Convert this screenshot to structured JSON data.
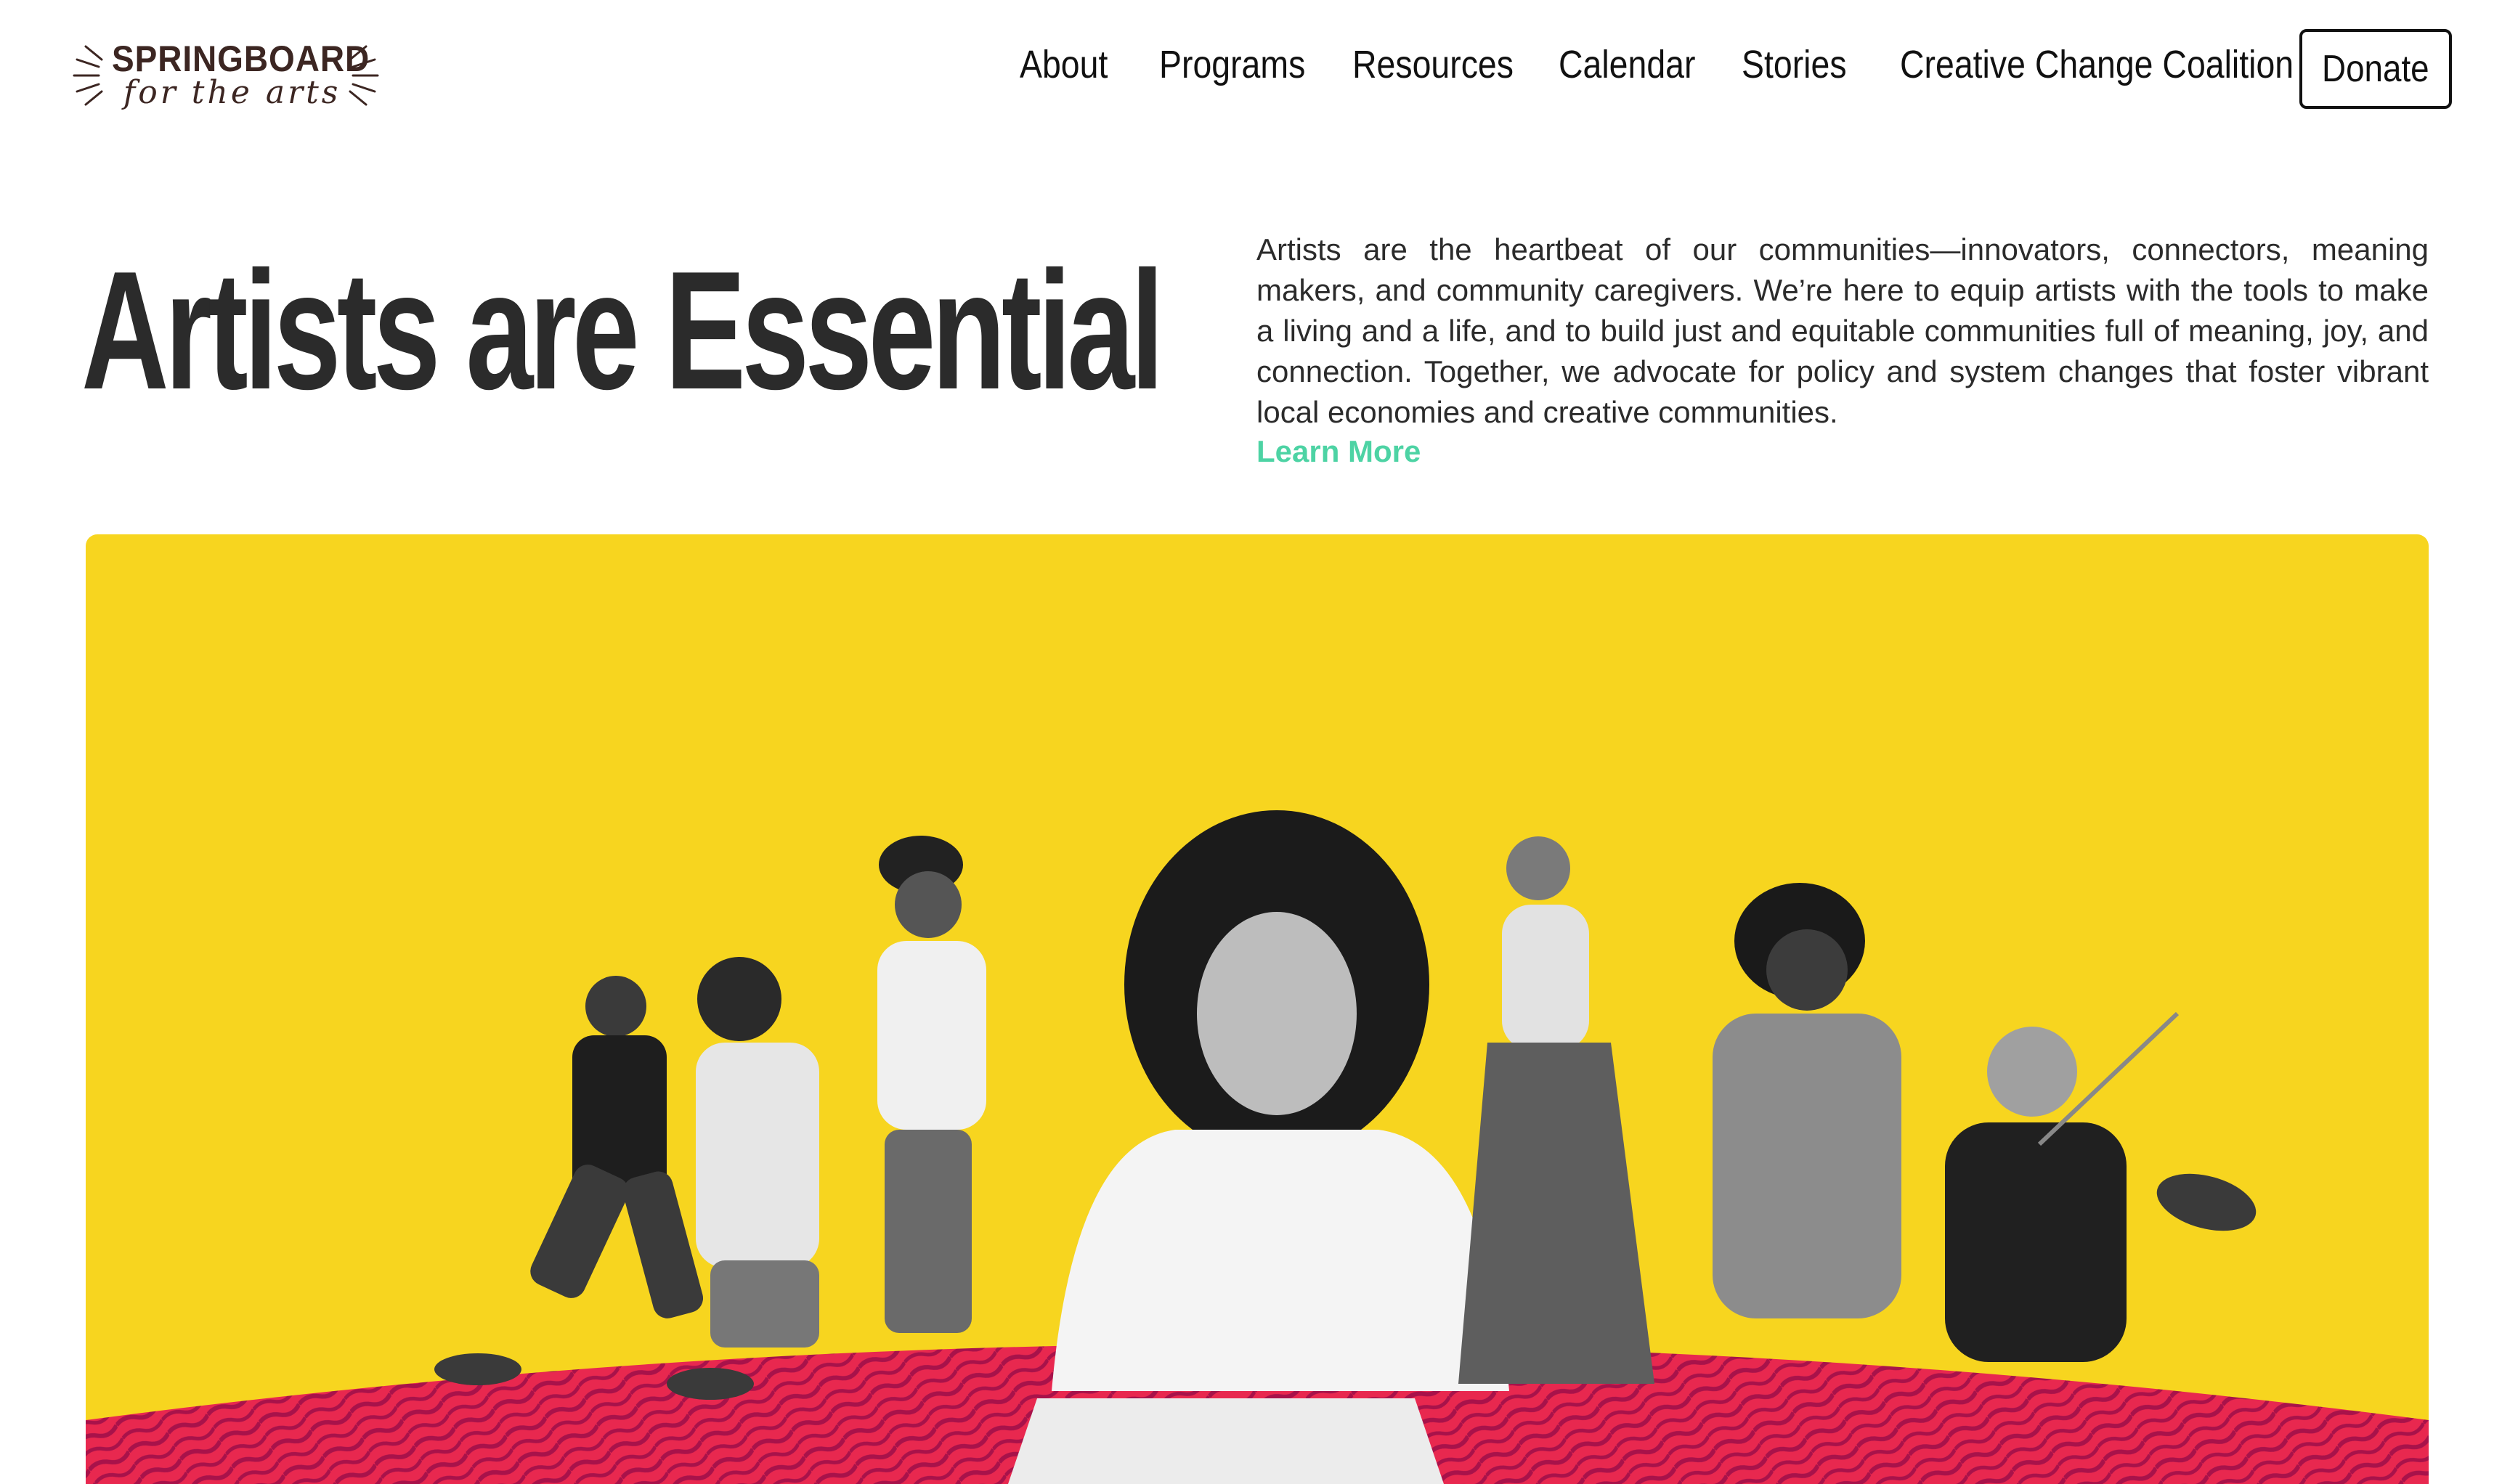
{
  "header": {
    "logo_text": "SPRINGBOARD",
    "logo_script": "for the arts",
    "nav": [
      "About",
      "Programs",
      "Resources",
      "Calendar",
      "Stories",
      "Creative Change Coalition"
    ],
    "donate_label": "Donate"
  },
  "hero": {
    "title": "Artists are Essential",
    "description": "Artists are the heartbeat of our communities—innovators, connectors, meaning makers, and community caregivers. We’re here to equip artists with the tools to make a living and a life, and to build just and equitable communities full of meaning, joy, and connection. Together, we advocate for policy and system changes that foster vibrant local economies and creative communities.",
    "learn_more": "Learn More"
  },
  "colors": {
    "accent_green": "#4dd3a4",
    "banner_yellow": "#f7d51f",
    "ground_red": "#e8284f",
    "text_dark": "#2b2b2b"
  },
  "icons": [
    "sunburst-icon"
  ]
}
